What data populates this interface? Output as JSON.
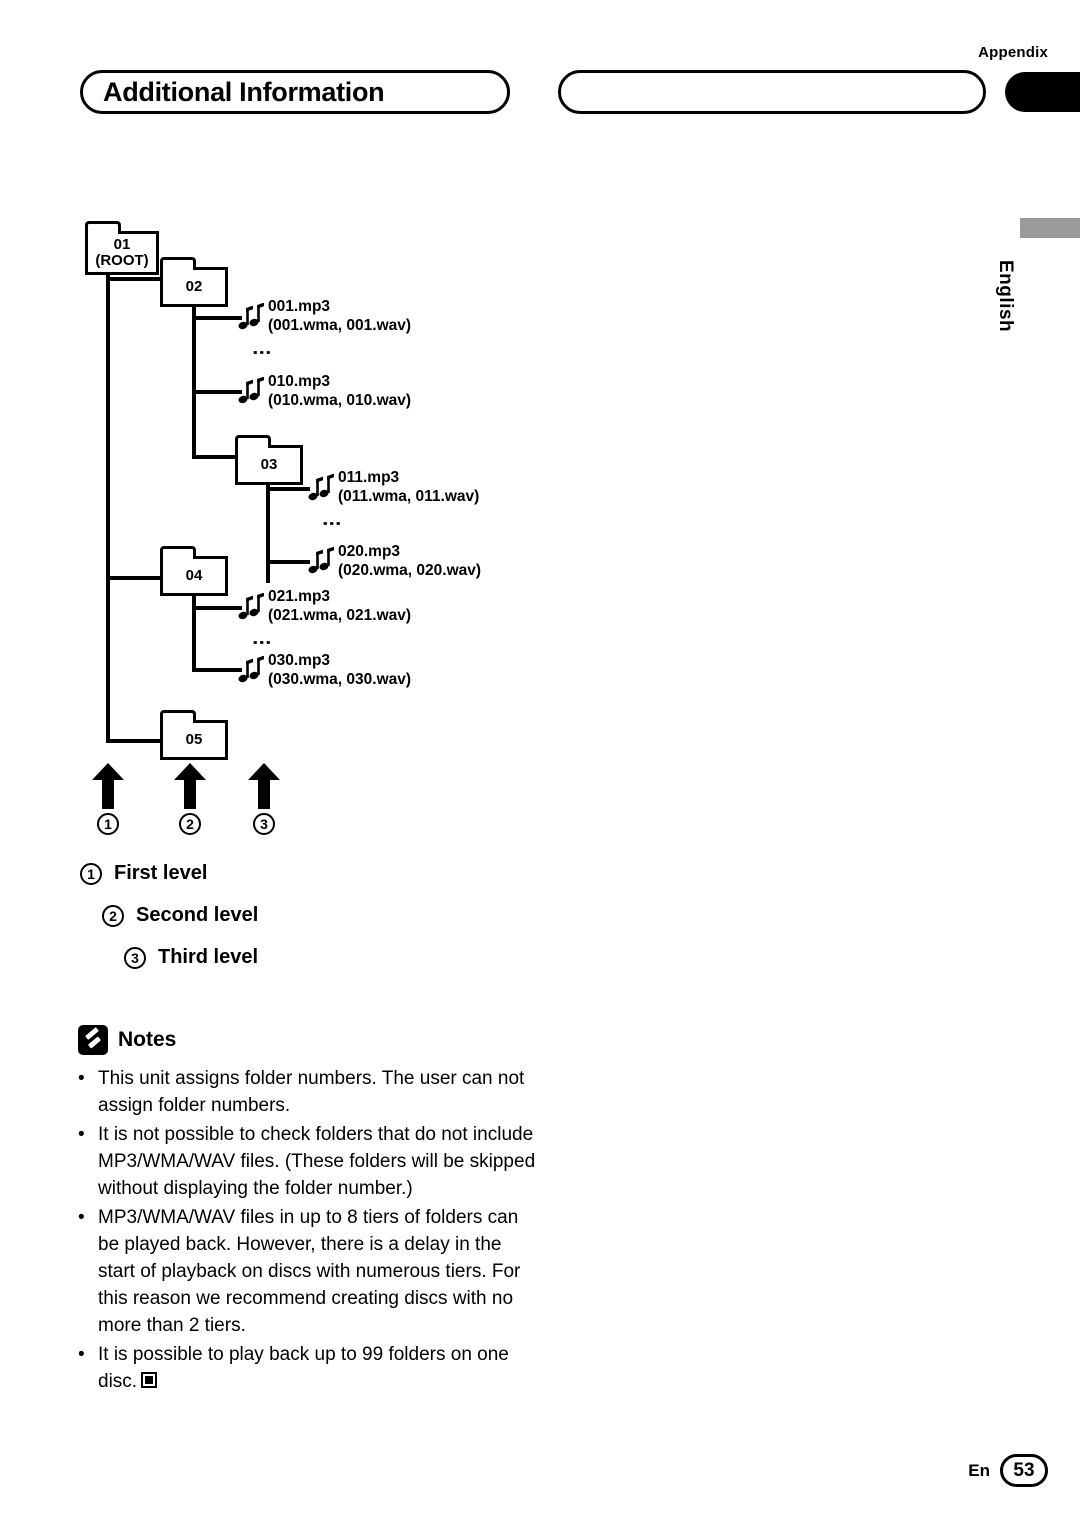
{
  "header": {
    "appendix": "Appendix",
    "title": "Additional Information",
    "language": "English"
  },
  "diagram": {
    "folders": [
      {
        "id": "root",
        "label_line1": "01",
        "label_line2": "(ROOT)"
      },
      {
        "id": "f02",
        "label_line1": "02",
        "label_line2": ""
      },
      {
        "id": "f03",
        "label_line1": "03",
        "label_line2": ""
      },
      {
        "id": "f04",
        "label_line1": "04",
        "label_line2": ""
      },
      {
        "id": "f05",
        "label_line1": "05",
        "label_line2": ""
      }
    ],
    "files": [
      {
        "line1": "001.mp3",
        "line2": "(001.wma, 001.wav)"
      },
      {
        "line1": "010.mp3",
        "line2": "(010.wma, 010.wav)"
      },
      {
        "line1": "011.mp3",
        "line2": "(011.wma, 011.wav)"
      },
      {
        "line1": "020.mp3",
        "line2": "(020.wma, 020.wav)"
      },
      {
        "line1": "021.mp3",
        "line2": "(021.wma, 021.wav)"
      },
      {
        "line1": "030.mp3",
        "line2": "(030.wma, 030.wav)"
      }
    ],
    "markers": [
      "1",
      "2",
      "3"
    ]
  },
  "legend": [
    {
      "num": "1",
      "label": "First level"
    },
    {
      "num": "2",
      "label": "Second level"
    },
    {
      "num": "3",
      "label": "Third level"
    }
  ],
  "notes": {
    "title": "Notes",
    "items": [
      "This unit assigns folder numbers. The user can not assign folder numbers.",
      "It is not possible to check folders that do not include MP3/WMA/WAV files. (These folders will be skipped without displaying the folder number.)",
      "MP3/WMA/WAV files in up to 8 tiers of folders can be played back. However, there is a delay in the start of playback on discs with numerous tiers. For this reason we recommend creating discs with no more than 2 tiers.",
      "It is possible to play back up to 99 folders on one disc."
    ]
  },
  "footer": {
    "lang_code": "En",
    "page": "53"
  }
}
